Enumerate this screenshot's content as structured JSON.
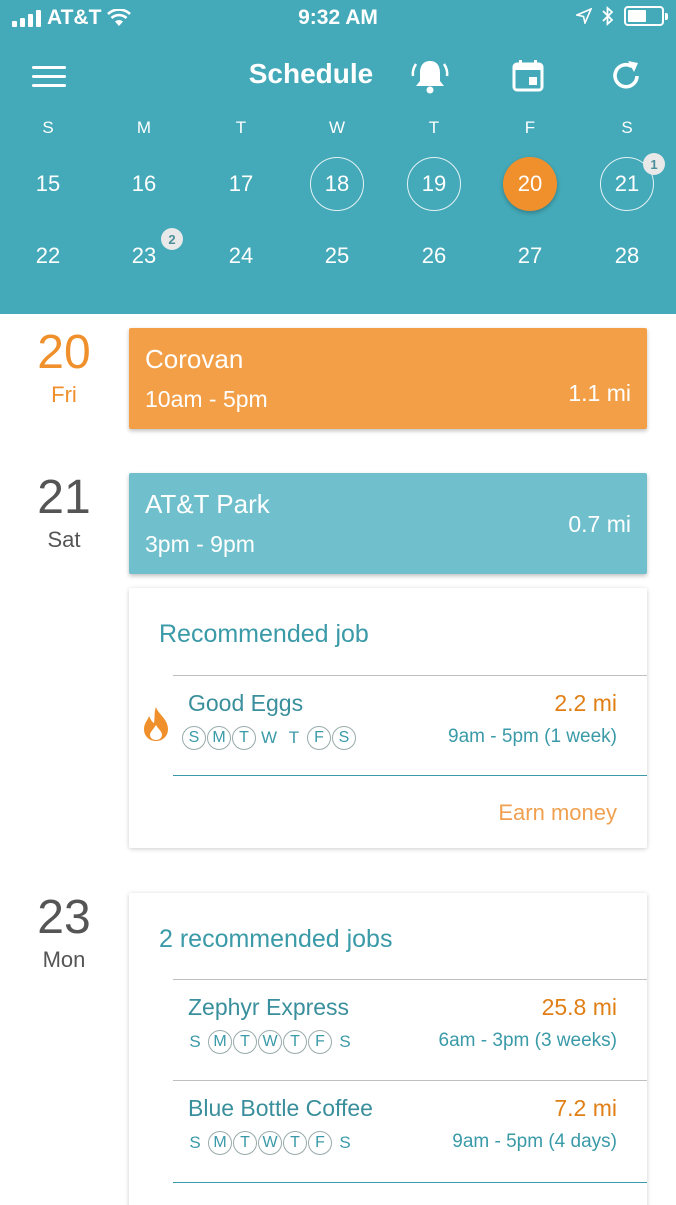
{
  "status_bar": {
    "carrier": "AT&T",
    "time": "9:32 AM"
  },
  "toolbar": {
    "title": "Schedule"
  },
  "calendar": {
    "weekdays": [
      "S",
      "M",
      "T",
      "W",
      "T",
      "F",
      "S"
    ],
    "week1": [
      "15",
      "16",
      "17",
      "18",
      "19",
      "20",
      "21"
    ],
    "week2": [
      "22",
      "23",
      "24",
      "25",
      "26",
      "27",
      "28"
    ],
    "selected": "20",
    "outlined": [
      "18",
      "19",
      "21"
    ],
    "badges": {
      "21": "1",
      "23": "2"
    }
  },
  "days": [
    {
      "num": "20",
      "name": "Fri"
    },
    {
      "num": "21",
      "name": "Sat"
    },
    {
      "num": "23",
      "name": "Mon"
    }
  ],
  "shifts": [
    {
      "name": "Corovan",
      "time": "10am - 5pm",
      "distance": "1.1 mi"
    },
    {
      "name": "AT&T Park",
      "time": "3pm - 9pm",
      "distance": "0.7 mi"
    }
  ],
  "rec1": {
    "title": "Recommended job",
    "job": {
      "name": "Good Eggs",
      "distance": "2.2 mi",
      "hours": "9am - 5pm (1 week)",
      "days": [
        "S",
        "M",
        "T",
        "W",
        "T",
        "F",
        "S"
      ],
      "active_days": [
        true,
        true,
        true,
        false,
        false,
        true,
        true
      ]
    },
    "action": "Earn money"
  },
  "rec2": {
    "title": "2 recommended jobs",
    "jobs": [
      {
        "name": "Zephyr Express",
        "distance": "25.8 mi",
        "hours": "6am - 3pm (3 weeks)",
        "days": [
          "S",
          "M",
          "T",
          "W",
          "T",
          "F",
          "S"
        ],
        "active_days": [
          false,
          true,
          true,
          true,
          true,
          true,
          false
        ]
      },
      {
        "name": "Blue Bottle Coffee",
        "distance": "7.2 mi",
        "hours": "9am - 5pm (4 days)",
        "days": [
          "S",
          "M",
          "T",
          "W",
          "T",
          "F",
          "S"
        ],
        "active_days": [
          false,
          true,
          true,
          true,
          true,
          true,
          false
        ]
      }
    ]
  },
  "colors": {
    "header": "#44a9b8",
    "accent_orange": "#f0902c",
    "teal_text": "#3a9aa8"
  }
}
